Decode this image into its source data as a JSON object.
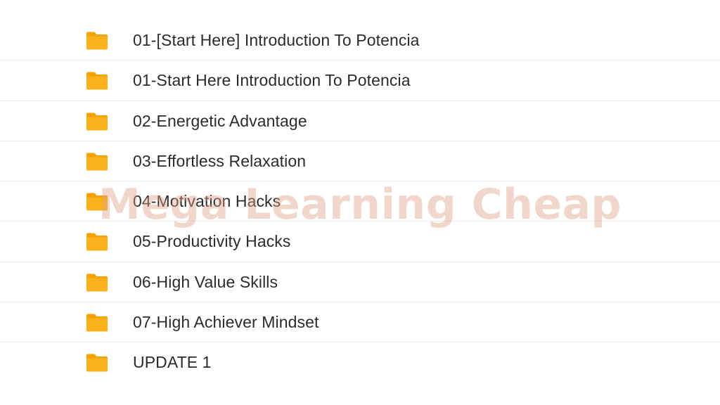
{
  "file_list": {
    "items": [
      {
        "name": "01-[Start Here] Introduction To Potencia",
        "icon": "folder-icon",
        "type": "folder"
      },
      {
        "name": "01-Start Here Introduction To Potencia",
        "icon": "folder-icon",
        "type": "folder"
      },
      {
        "name": "02-Energetic Advantage",
        "icon": "folder-icon",
        "type": "folder"
      },
      {
        "name": "03-Effortless Relaxation",
        "icon": "folder-icon",
        "type": "folder"
      },
      {
        "name": "04-Motivation Hacks",
        "icon": "folder-icon",
        "type": "folder"
      },
      {
        "name": "05-Productivity Hacks",
        "icon": "folder-icon",
        "type": "folder"
      },
      {
        "name": "06-High Value Skills",
        "icon": "folder-icon",
        "type": "folder"
      },
      {
        "name": "07-High Achiever Mindset",
        "icon": "folder-icon",
        "type": "folder"
      },
      {
        "name": "UPDATE 1",
        "icon": "folder-icon",
        "type": "folder"
      }
    ]
  },
  "watermark": {
    "text": "Mega Learning Cheap"
  },
  "colors": {
    "folder": "#F9B21B",
    "folder_tab": "#F5A100",
    "text": "#2b2b2b",
    "divider": "#ececec",
    "watermark": "#DEA084"
  }
}
